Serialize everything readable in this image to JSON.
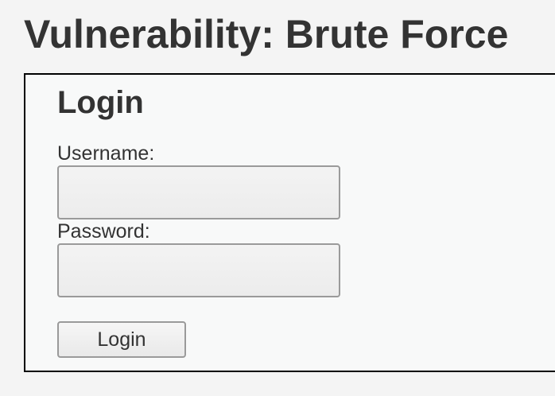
{
  "page": {
    "title": "Vulnerability: Brute Force"
  },
  "login_form": {
    "heading": "Login",
    "username_label": "Username:",
    "username_value": "",
    "password_label": "Password:",
    "password_value": "",
    "submit_label": "Login"
  }
}
